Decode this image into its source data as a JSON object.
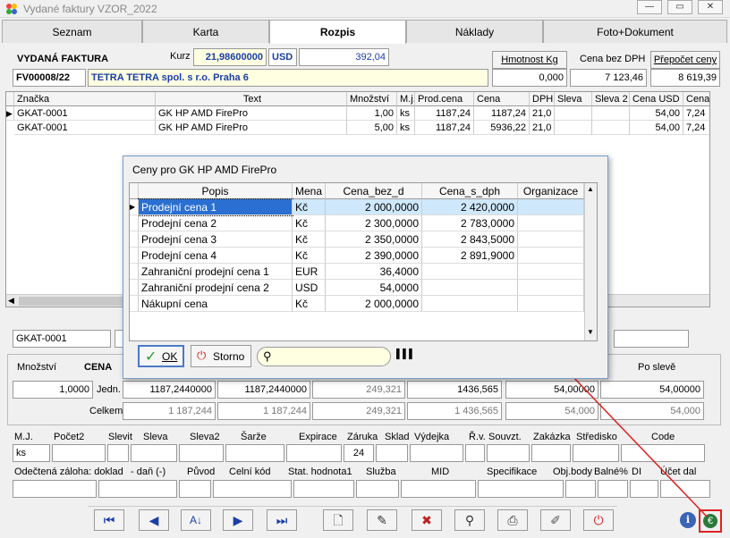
{
  "window": {
    "title": "Vydané faktury VZOR_2022",
    "minimize": "—",
    "restore": "▭",
    "close": "✕"
  },
  "tabs": [
    {
      "label": "Seznam",
      "active": false
    },
    {
      "label": "Karta",
      "active": false
    },
    {
      "label": "Rozpis",
      "active": true
    },
    {
      "label": "Náklady",
      "active": false
    },
    {
      "label": "Foto+Dokument",
      "active": false
    }
  ],
  "header": {
    "doc_type": "VYDANÁ FAKTURA",
    "kurz_label": "Kurz",
    "kurz_value": "21,98600000",
    "currency": "USD",
    "amount": "392,04",
    "doc_number": "FV00008/22",
    "customer": "TETRA TETRA spol. s r.o.  Praha 6",
    "hmotnost_label": "Hmotnost Kg",
    "hmotnost_value": "0,000",
    "cena_bez_dph_label": "Cena bez DPH",
    "cena_bez_dph_value": "7 123,46",
    "prepocet_label": "Přepočet ceny",
    "prepocet_value": "8 619,39"
  },
  "grid": {
    "columns": [
      "Značka",
      "Text",
      "Množství",
      "M.j.",
      "Prod.cena",
      "Cena",
      "DPH",
      "Sleva",
      "Sleva 2",
      "Cena USD",
      "Cena"
    ],
    "rows": [
      [
        "GKAT-0001",
        "GK HP AMD FirePro",
        "1,00",
        "ks",
        "1187,24",
        "1187,24",
        "21,0",
        "",
        "",
        "54,00",
        "7,24"
      ],
      [
        "GKAT-0001",
        "GK HP AMD FirePro",
        "5,00",
        "ks",
        "1187,24",
        "5936,22",
        "21,0",
        "",
        "",
        "54,00",
        "7,24"
      ]
    ]
  },
  "dialog": {
    "title": "Ceny pro GK HP AMD FirePro",
    "columns": [
      "Popis",
      "Mena",
      "Cena_bez_d",
      "Cena_s_dph",
      "Organizace"
    ],
    "rows": [
      [
        "Prodejní cena 1",
        "Kč",
        "2 000,0000",
        "2 420,0000",
        ""
      ],
      [
        "Prodejní cena 2",
        "Kč",
        "2 300,0000",
        "2 783,0000",
        ""
      ],
      [
        "Prodejní cena 3",
        "Kč",
        "2 350,0000",
        "2 843,5000",
        ""
      ],
      [
        "Prodejní cena 4",
        "Kč",
        "2 390,0000",
        "2 891,9000",
        ""
      ],
      [
        "Zahraniční prodejní cena 1",
        "EUR",
        "36,4000",
        "",
        ""
      ],
      [
        "Zahraniční prodejní cena 2",
        "USD",
        "54,0000",
        "",
        ""
      ],
      [
        "Nákupní cena",
        "Kč",
        "2 000,0000",
        "",
        ""
      ]
    ],
    "ok_label": "OK",
    "storno_label": "Storno",
    "search_value": ""
  },
  "detail": {
    "code_value": "GKAT-0001",
    "mnozstvi_label": "Množství",
    "mnozstvi_value": "1,0000",
    "cena_label": "CENA",
    "po_sleve_label": "Po slevě",
    "jedn_label": "Jedn.",
    "celkem_label": "Celkem",
    "jedn_values": [
      "1187,2440000",
      "1187,2440000",
      "249,321",
      "1436,565",
      "54,00000",
      "54,00000"
    ],
    "celkem_values": [
      "1 187,244",
      "1 187,244",
      "249,321",
      "1 436,565",
      "54,000",
      "54,000"
    ]
  },
  "fields_row1": {
    "labels": [
      "M.J.",
      "Počet2",
      "Slevit",
      "Sleva",
      "Sleva2",
      "Šarže",
      "Expirace",
      "Záruka",
      "Sklad",
      "Výdejka",
      "Ř.v.",
      "Souvzt.",
      "Zakázka",
      "Středisko",
      "Code"
    ],
    "mj_value": "ks",
    "zaruka_value": "24"
  },
  "fields_row2": {
    "labels": [
      "Odečtená záloha: doklad",
      "- daň (-)",
      "Původ",
      "Celní kód",
      "Stat. hodnota1",
      "Služba",
      "MID",
      "Specifikace",
      "Obj.body",
      "Balné%",
      "DI",
      "Účet dal"
    ]
  },
  "toolbar": {
    "buttons": [
      "first-record",
      "previous-record",
      "sort",
      "next-record",
      "last-record",
      "new-document",
      "edit",
      "delete",
      "binoculars",
      "print",
      "tools",
      "power"
    ]
  },
  "status_icons": [
    "info",
    "euro"
  ]
}
